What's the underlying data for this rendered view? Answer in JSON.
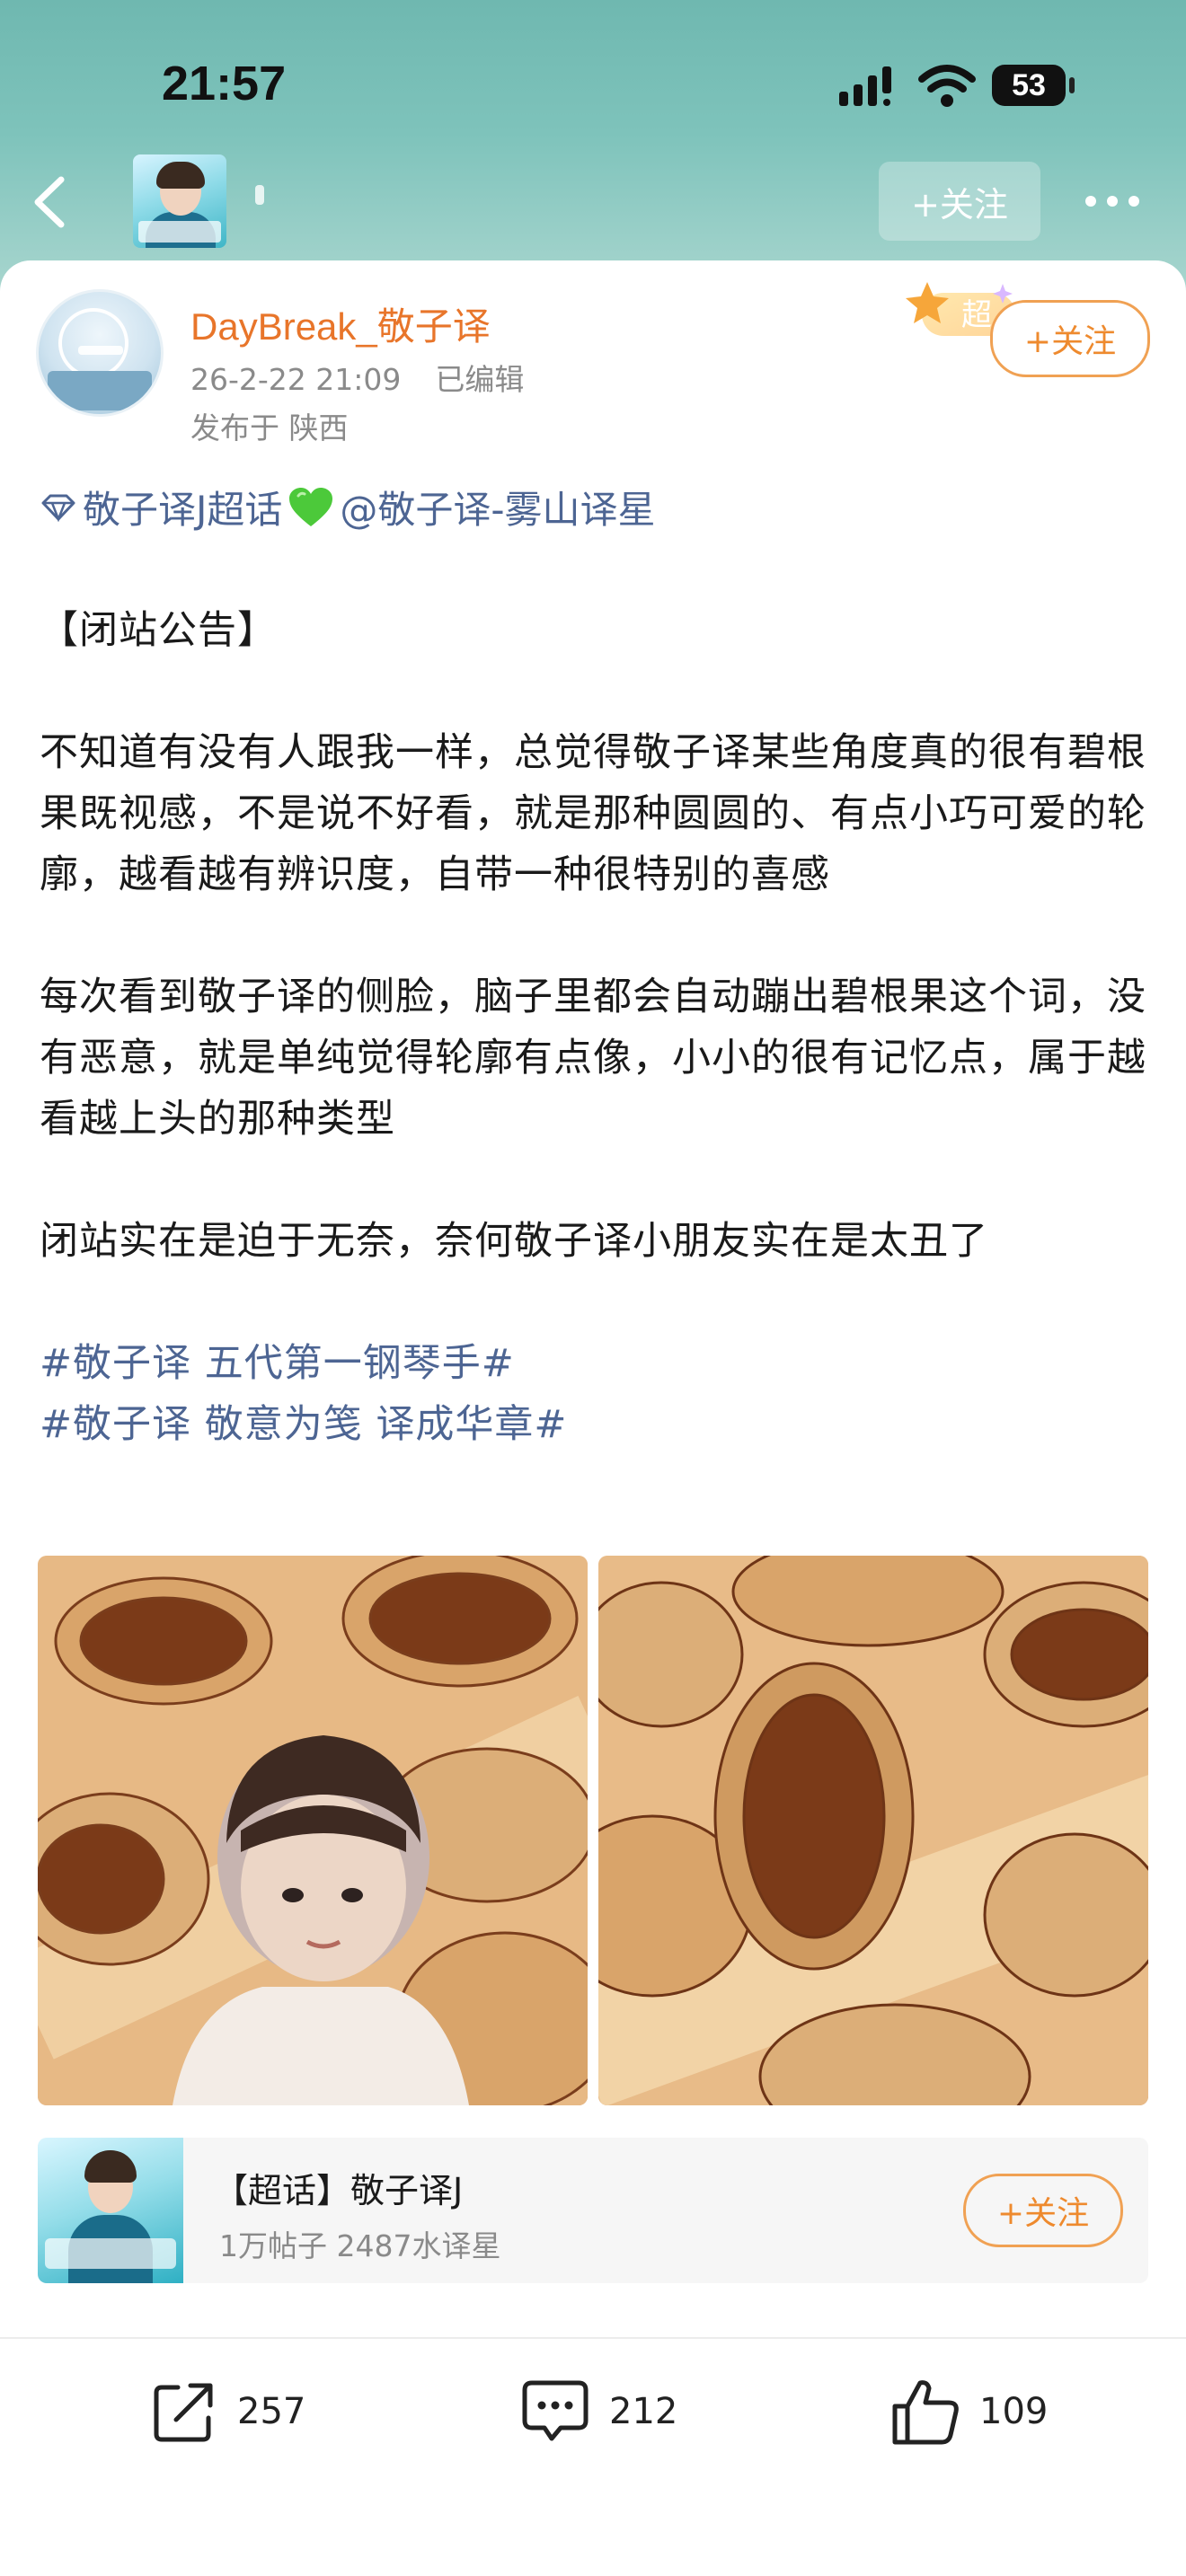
{
  "status_bar": {
    "time": "21:57",
    "battery": "53"
  },
  "header": {
    "follow_label": "+关注"
  },
  "author": {
    "name": "DayBreak_敬子译",
    "date": "26-2-22 21:09",
    "edited": "已编辑",
    "location": "发布于 陕西",
    "super_badge": "超",
    "follow_label": "+关注"
  },
  "post": {
    "topic_mention": "敬子译J超话",
    "user_mention": "@敬子译-雾山译星",
    "paragraphs": [
      "【闭站公告】",
      "不知道有没有人跟我一样，总觉得敬子译某些角度真的很有碧根果既视感，不是说不好看，就是那种圆圆的、有点小巧可爱的轮廓，越看越有辨识度，自带一种很特别的喜感",
      "每次看到敬子译的侧脸，脑子里都会自动蹦出碧根果这个词，没有恶意，就是单纯觉得轮廓有点像，小小的很有记忆点，属于越看越上头的那种类型",
      "闭站实在是迫于无奈，奈何敬子译小朋友实在是太丑了"
    ],
    "hashtags": [
      "#敬子译 五代第一钢琴手#",
      "#敬子译 敬意为笺 译成华章#"
    ]
  },
  "super_topic": {
    "title": "【超话】敬子译J",
    "stats": "1万帖子 2487水译星",
    "follow_label": "+关注"
  },
  "actions": {
    "share_count": "257",
    "comment_count": "212",
    "like_count": "109"
  },
  "colors": {
    "accent_orange": "#ee8a2e",
    "link_blue": "#4d6593",
    "header_teal": "#7ec3bb"
  }
}
